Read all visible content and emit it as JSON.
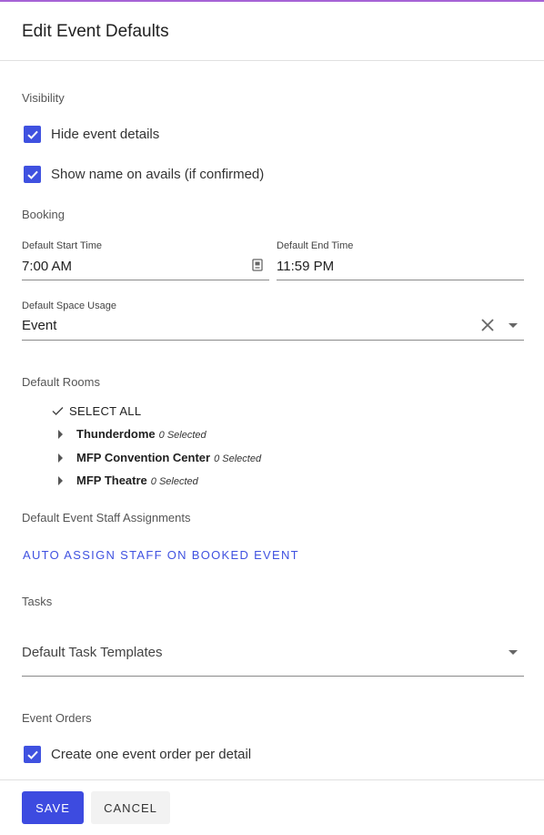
{
  "dialog": {
    "title": "Edit Event Defaults"
  },
  "visibility": {
    "label": "Visibility",
    "hide_details": {
      "label": "Hide event details",
      "checked": true
    },
    "show_name": {
      "label": "Show name on avails (if confirmed)",
      "checked": true
    }
  },
  "booking": {
    "label": "Booking",
    "start_time": {
      "caption": "Default Start Time",
      "value": "7:00 AM"
    },
    "end_time": {
      "caption": "Default End Time",
      "value": "11:59 PM"
    },
    "space_usage": {
      "caption": "Default Space Usage",
      "value": "Event"
    }
  },
  "rooms": {
    "label": "Default Rooms",
    "select_all": "SELECT ALL",
    "items": [
      {
        "name": "Thunderdome",
        "count": "0 Selected"
      },
      {
        "name": "MFP Convention Center",
        "count": "0 Selected"
      },
      {
        "name": "MFP Theatre",
        "count": "0 Selected"
      }
    ]
  },
  "staff": {
    "label": "Default Event Staff Assignments",
    "auto_assign": "AUTO ASSIGN STAFF ON BOOKED EVENT"
  },
  "tasks": {
    "label": "Tasks",
    "templates_placeholder": "Default Task Templates"
  },
  "event_orders": {
    "label": "Event Orders",
    "per_detail": {
      "label": "Create one event order per detail",
      "checked": true
    }
  },
  "footer": {
    "save": "SAVE",
    "cancel": "CANCEL"
  },
  "colors": {
    "accent": "#3f51e0",
    "top_bar": "#a663d6"
  }
}
